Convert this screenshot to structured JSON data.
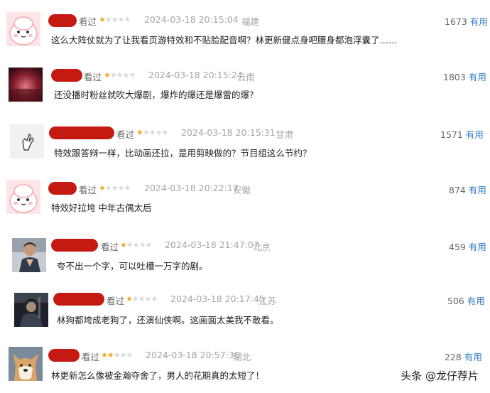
{
  "reviews": [
    {
      "avatar": "pink-cartoon",
      "name_redacted": true,
      "watched": "看过",
      "stars": 1,
      "time": "2024-03-18 20:15:04",
      "location": "福建",
      "votes": "1673",
      "useful": "有用",
      "text": "这么大阵仗就为了让我看页游特效和不贴脸配音啊？林更新健点身吧腰身都泡浮囊了……"
    },
    {
      "avatar": "dark-red-photo",
      "name_redacted": true,
      "watched": "看过",
      "stars": 1,
      "time": "2024-03-18 20:15:24",
      "location": "云南",
      "votes": "1803",
      "useful": "有用",
      "text": "还没播时粉丝就吹大爆剧，爆炸的爆还是爆雷的爆？"
    },
    {
      "avatar": "hand-gesture",
      "name_redacted": true,
      "watched": "看过",
      "stars": 1,
      "time": "2024-03-18 20:15:31",
      "location": "甘肃",
      "votes": "1571",
      "useful": "有用",
      "text": "特效跟答辩一样，比动画还拉，是用剪映做的？节目组这么节约？"
    },
    {
      "avatar": "pink-cartoon",
      "name_redacted": true,
      "watched": "看过",
      "stars": 1,
      "time": "2024-03-18 20:22:17",
      "location": "安徽",
      "votes": "874",
      "useful": "有用",
      "text": "特效好拉垮 中年古偶太后"
    },
    {
      "avatar": "person-photo",
      "name_redacted": true,
      "watched": "看过",
      "stars": 1,
      "time": "2024-03-18 21:47:07",
      "location": "北京",
      "votes": "459",
      "useful": "有用",
      "text": "夸不出一个字，可以吐槽一万字的剧。"
    },
    {
      "avatar": "dark-photo",
      "name_redacted": true,
      "watched": "看过",
      "stars": 1,
      "time": "2024-03-18 20:17:45",
      "location": "江苏",
      "votes": "506",
      "useful": "有用",
      "text": "林狗都垮成老狗了，还演仙侠啊。这画面太美我不敢看。"
    },
    {
      "avatar": "shiba-dog",
      "name_redacted": true,
      "watched": "看过",
      "stars": 2,
      "time": "2024-03-18 20:57:30",
      "location": "湖北",
      "votes": "228",
      "useful": "有用",
      "text": "林更新怎么像被金瀚夺舍了，男人的花期真的太短了！"
    }
  ],
  "watermark": "头条 @龙仔荐片",
  "colors": {
    "redact": "#c41a12",
    "star_on": "#f5a623",
    "star_off": "#d8d8d8",
    "useful_link": "#2f7bc4",
    "meta": "#a5a5a5"
  }
}
